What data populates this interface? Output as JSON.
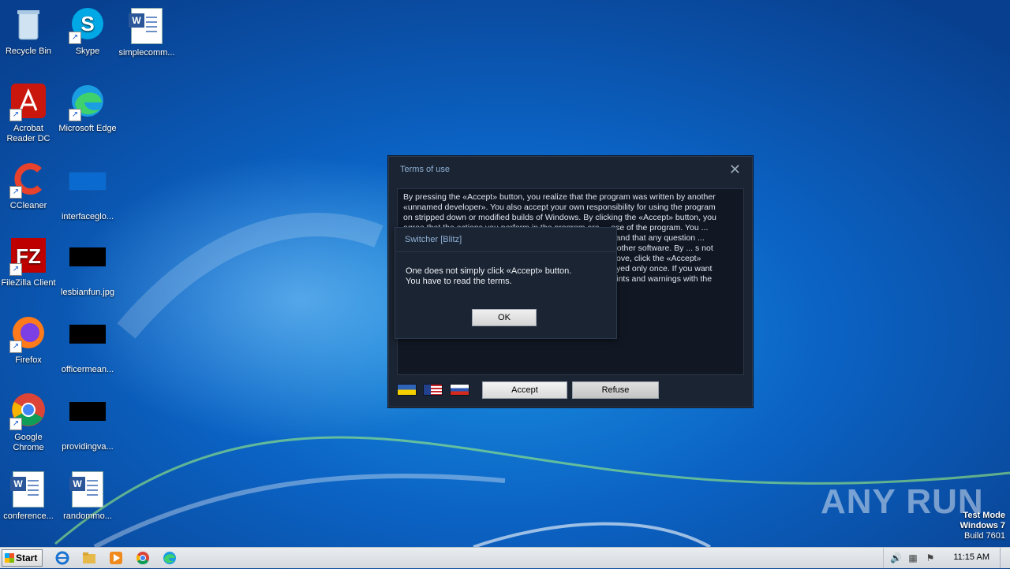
{
  "desktop": {
    "icons": [
      {
        "label": "Recycle Bin"
      },
      {
        "label": "Skype"
      },
      {
        "label": "simplecomm..."
      },
      {
        "label": "Acrobat Reader DC"
      },
      {
        "label": "Microsoft Edge"
      },
      {
        "label": "CCleaner"
      },
      {
        "label": "interfaceglo..."
      },
      {
        "label": "FileZilla Client"
      },
      {
        "label": "lesbianfun.jpg"
      },
      {
        "label": "Firefox"
      },
      {
        "label": "officermean..."
      },
      {
        "label": "Google Chrome"
      },
      {
        "label": "providingva..."
      },
      {
        "label": "conference..."
      },
      {
        "label": "randommo..."
      }
    ]
  },
  "terms_window": {
    "title": "Terms of use",
    "close_glyph": "✕",
    "text": "By pressing the «Accept» button, you realize that the program was written by another «unnamed developer». You also accept your own responsibility for using the program on stripped down or modified builds of Windows. By clicking the «Accept» button, you agree that the actions you perform in the program are ... ose of the program. You ... rogram and the «author» ... or the hacker are generally ... and that any question ... directed to the creators of ... rogram is responsible only ... other software. By ... s not responsible for the ... at affect the integrity of ... scribed above, click the «Accept» button with the right mouse button. This message is displayed only once. If you want to read it again, go to the program settings and reset the hints and warnings with the corresponding switch.",
    "accept_label": "Accept",
    "refuse_label": "Refuse",
    "flags": [
      "ukraine-flag",
      "usa-flag",
      "russia-flag"
    ]
  },
  "switcher_dialog": {
    "title": "Switcher [Blitz]",
    "message_line1": "One does not simply click «Accept» button.",
    "message_line2": "You have to read the terms.",
    "ok_label": "OK"
  },
  "watermark": {
    "brand": "ANY RUN",
    "test_mode": "Test Mode",
    "os": "Windows 7",
    "build": "Build 7601"
  },
  "taskbar": {
    "start_label": "Start",
    "pinned": [
      "internet-explorer-icon",
      "explorer-folder-icon",
      "media-player-icon",
      "chrome-icon",
      "edge-icon"
    ],
    "clock": "11:15 AM"
  },
  "colors": {
    "dialog_bg": "#1b2433",
    "dialog_title": "#8fb1d6",
    "desktop_blue": "#0b63c4"
  }
}
